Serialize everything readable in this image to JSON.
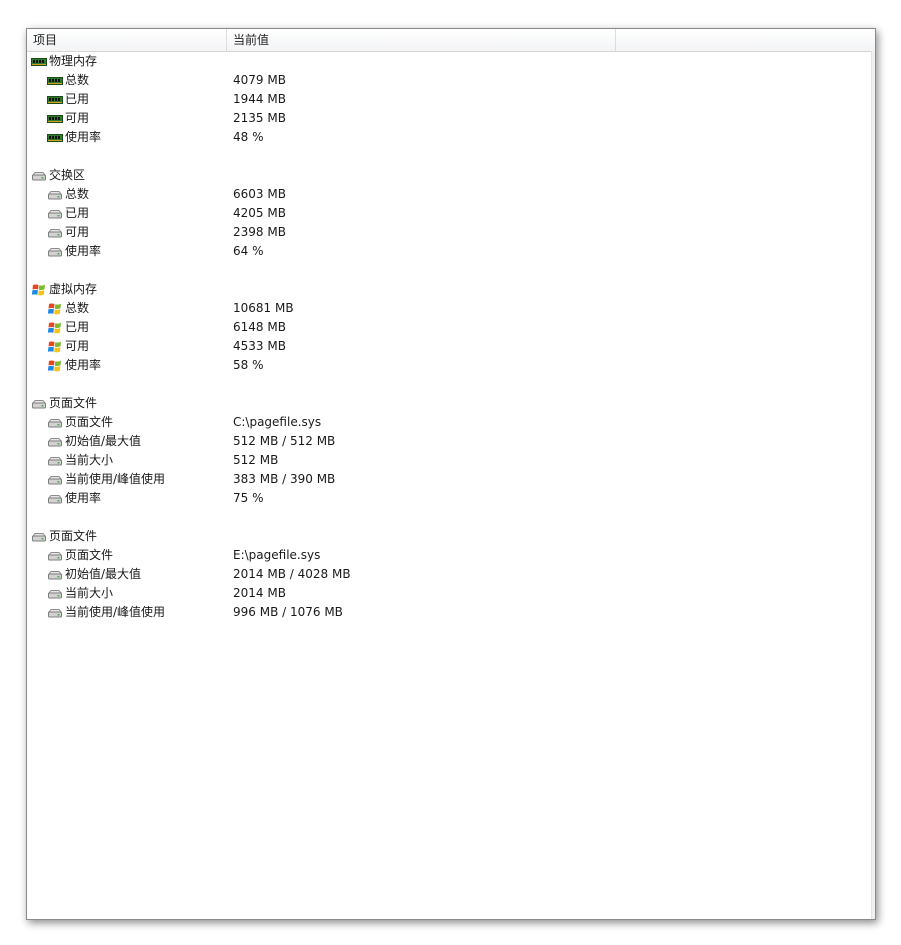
{
  "columns": {
    "item": "项目",
    "current_value": "当前值",
    "extra": ""
  },
  "groups": [
    {
      "label": "物理内存",
      "icon": "memory-chip-icon",
      "items": [
        {
          "label": "总数",
          "value": "4079 MB"
        },
        {
          "label": "已用",
          "value": "1944 MB"
        },
        {
          "label": "可用",
          "value": "2135 MB"
        },
        {
          "label": "使用率",
          "value": "48 %"
        }
      ]
    },
    {
      "label": "交换区",
      "icon": "hard-drive-icon",
      "items": [
        {
          "label": "总数",
          "value": "6603 MB"
        },
        {
          "label": "已用",
          "value": "4205 MB"
        },
        {
          "label": "可用",
          "value": "2398 MB"
        },
        {
          "label": "使用率",
          "value": "64 %"
        }
      ]
    },
    {
      "label": "虚拟内存",
      "icon": "windows-logo-icon",
      "items": [
        {
          "label": "总数",
          "value": "10681 MB"
        },
        {
          "label": "已用",
          "value": "6148 MB"
        },
        {
          "label": "可用",
          "value": "4533 MB"
        },
        {
          "label": "使用率",
          "value": "58 %"
        }
      ]
    },
    {
      "label": "页面文件",
      "icon": "hard-drive-icon",
      "items": [
        {
          "label": "页面文件",
          "value": "C:\\pagefile.sys"
        },
        {
          "label": "初始值/最大值",
          "value": "512 MB / 512 MB"
        },
        {
          "label": "当前大小",
          "value": "512 MB"
        },
        {
          "label": "当前使用/峰值使用",
          "value": "383 MB / 390 MB"
        },
        {
          "label": "使用率",
          "value": "75 %"
        }
      ]
    },
    {
      "label": "页面文件",
      "icon": "hard-drive-icon",
      "items": [
        {
          "label": "页面文件",
          "value": "E:\\pagefile.sys"
        },
        {
          "label": "初始值/最大值",
          "value": "2014 MB / 4028 MB"
        },
        {
          "label": "当前大小",
          "value": "2014 MB"
        },
        {
          "label": "当前使用/峰值使用",
          "value": "996 MB / 1076 MB"
        }
      ]
    }
  ]
}
